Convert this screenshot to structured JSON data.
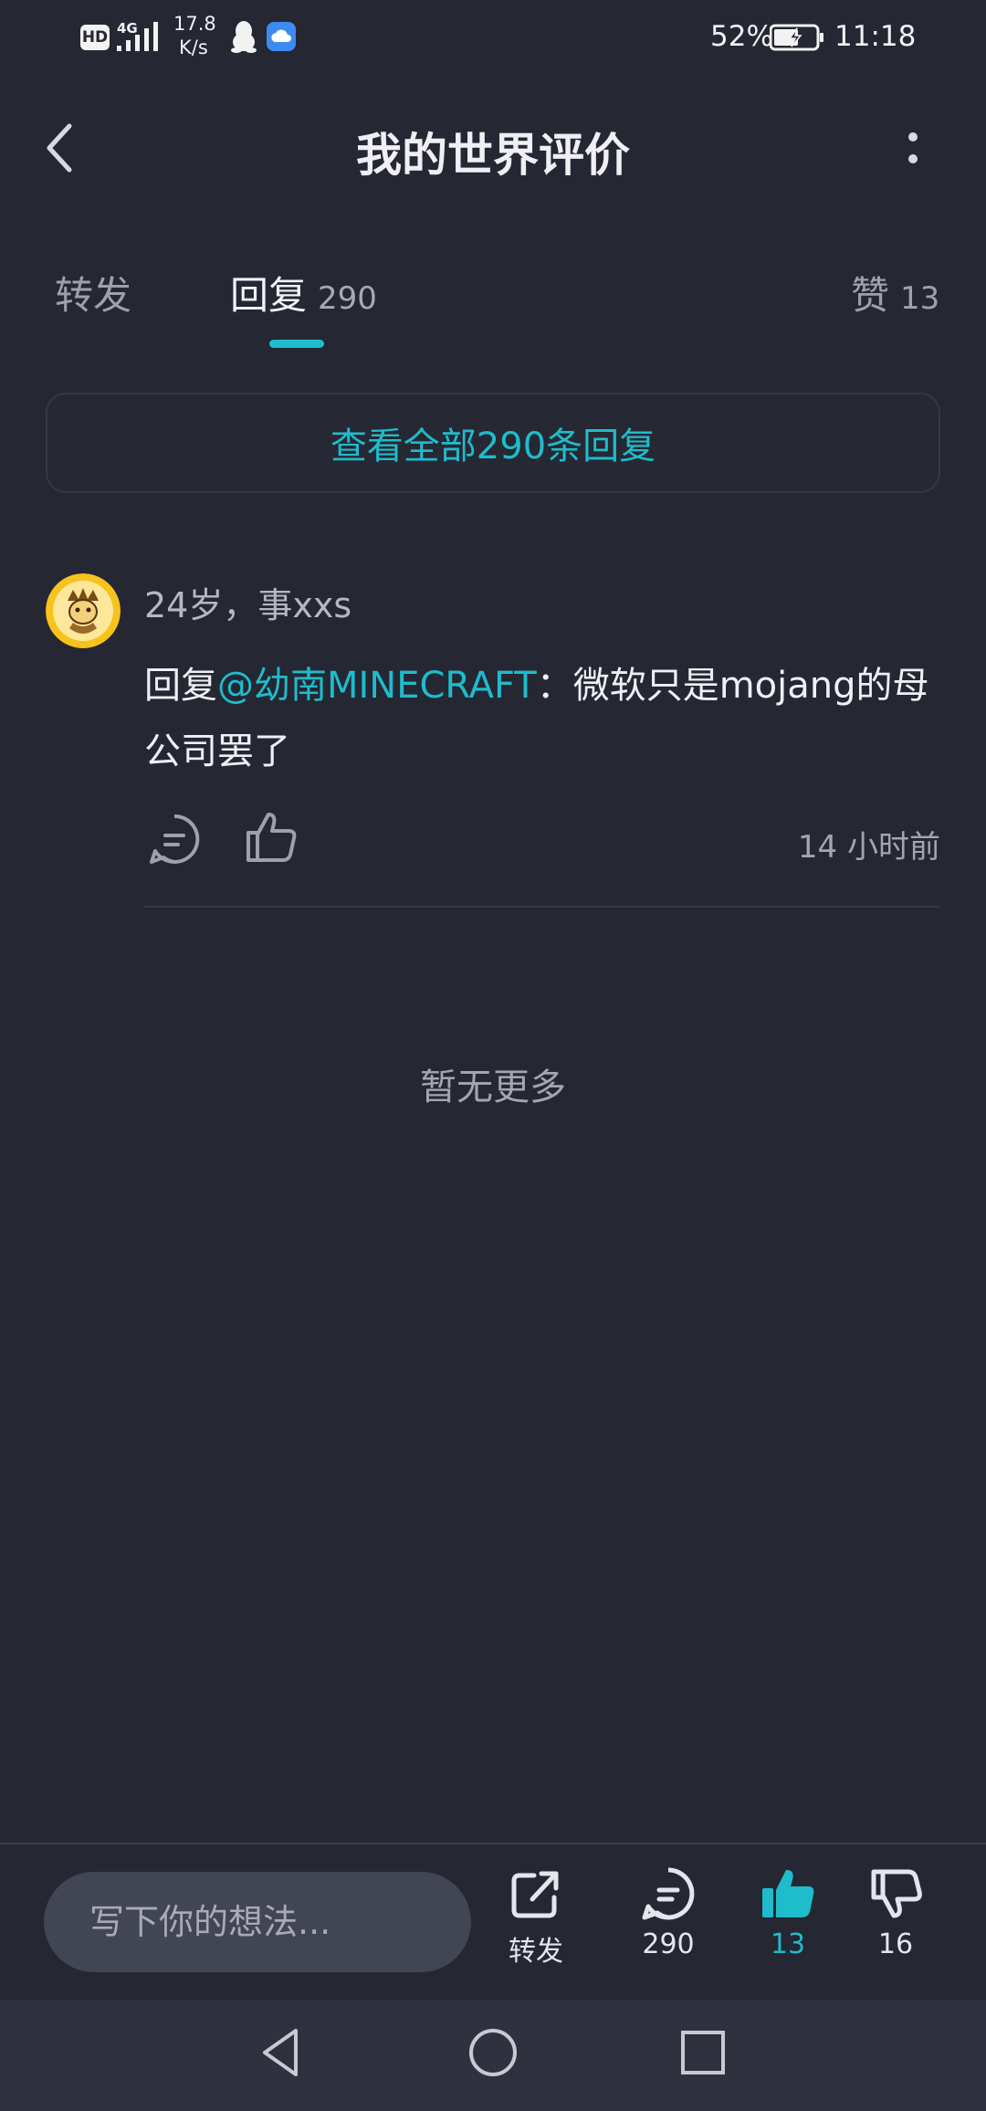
{
  "status_bar": {
    "hd_badge": "HD",
    "network": "4G",
    "speed_value": "17.8",
    "speed_unit": "K/s",
    "battery": "52%",
    "time": "11:18",
    "icons": [
      "qq-penguin-icon",
      "cloud-app-icon",
      "battery-charging-icon"
    ]
  },
  "header": {
    "title": "我的世界评价",
    "back_icon": "chevron-left-icon",
    "more_icon": "more-vertical-icon"
  },
  "tabs": {
    "forward": {
      "label": "转发"
    },
    "reply": {
      "label": "回复",
      "count": "290"
    },
    "like": {
      "label": "赞",
      "count": "13"
    }
  },
  "view_all": {
    "label": "查看全部290条回复"
  },
  "comment": {
    "username": "24岁，事xxs",
    "prefix": "回复",
    "mention": "@幼南MINECRAFT",
    "text": "：微软只是mojang的母公司罢了",
    "time": "14 小时前"
  },
  "no_more": "暂无更多",
  "bottom_bar": {
    "input_placeholder": "写下你的想法...",
    "share_label": "转发",
    "comment_count": "290",
    "like_count": "13",
    "dislike_count": "16"
  },
  "colors": {
    "background": "#252733",
    "accent": "#1fbccb",
    "secondary_text": "#a3a6b1"
  }
}
